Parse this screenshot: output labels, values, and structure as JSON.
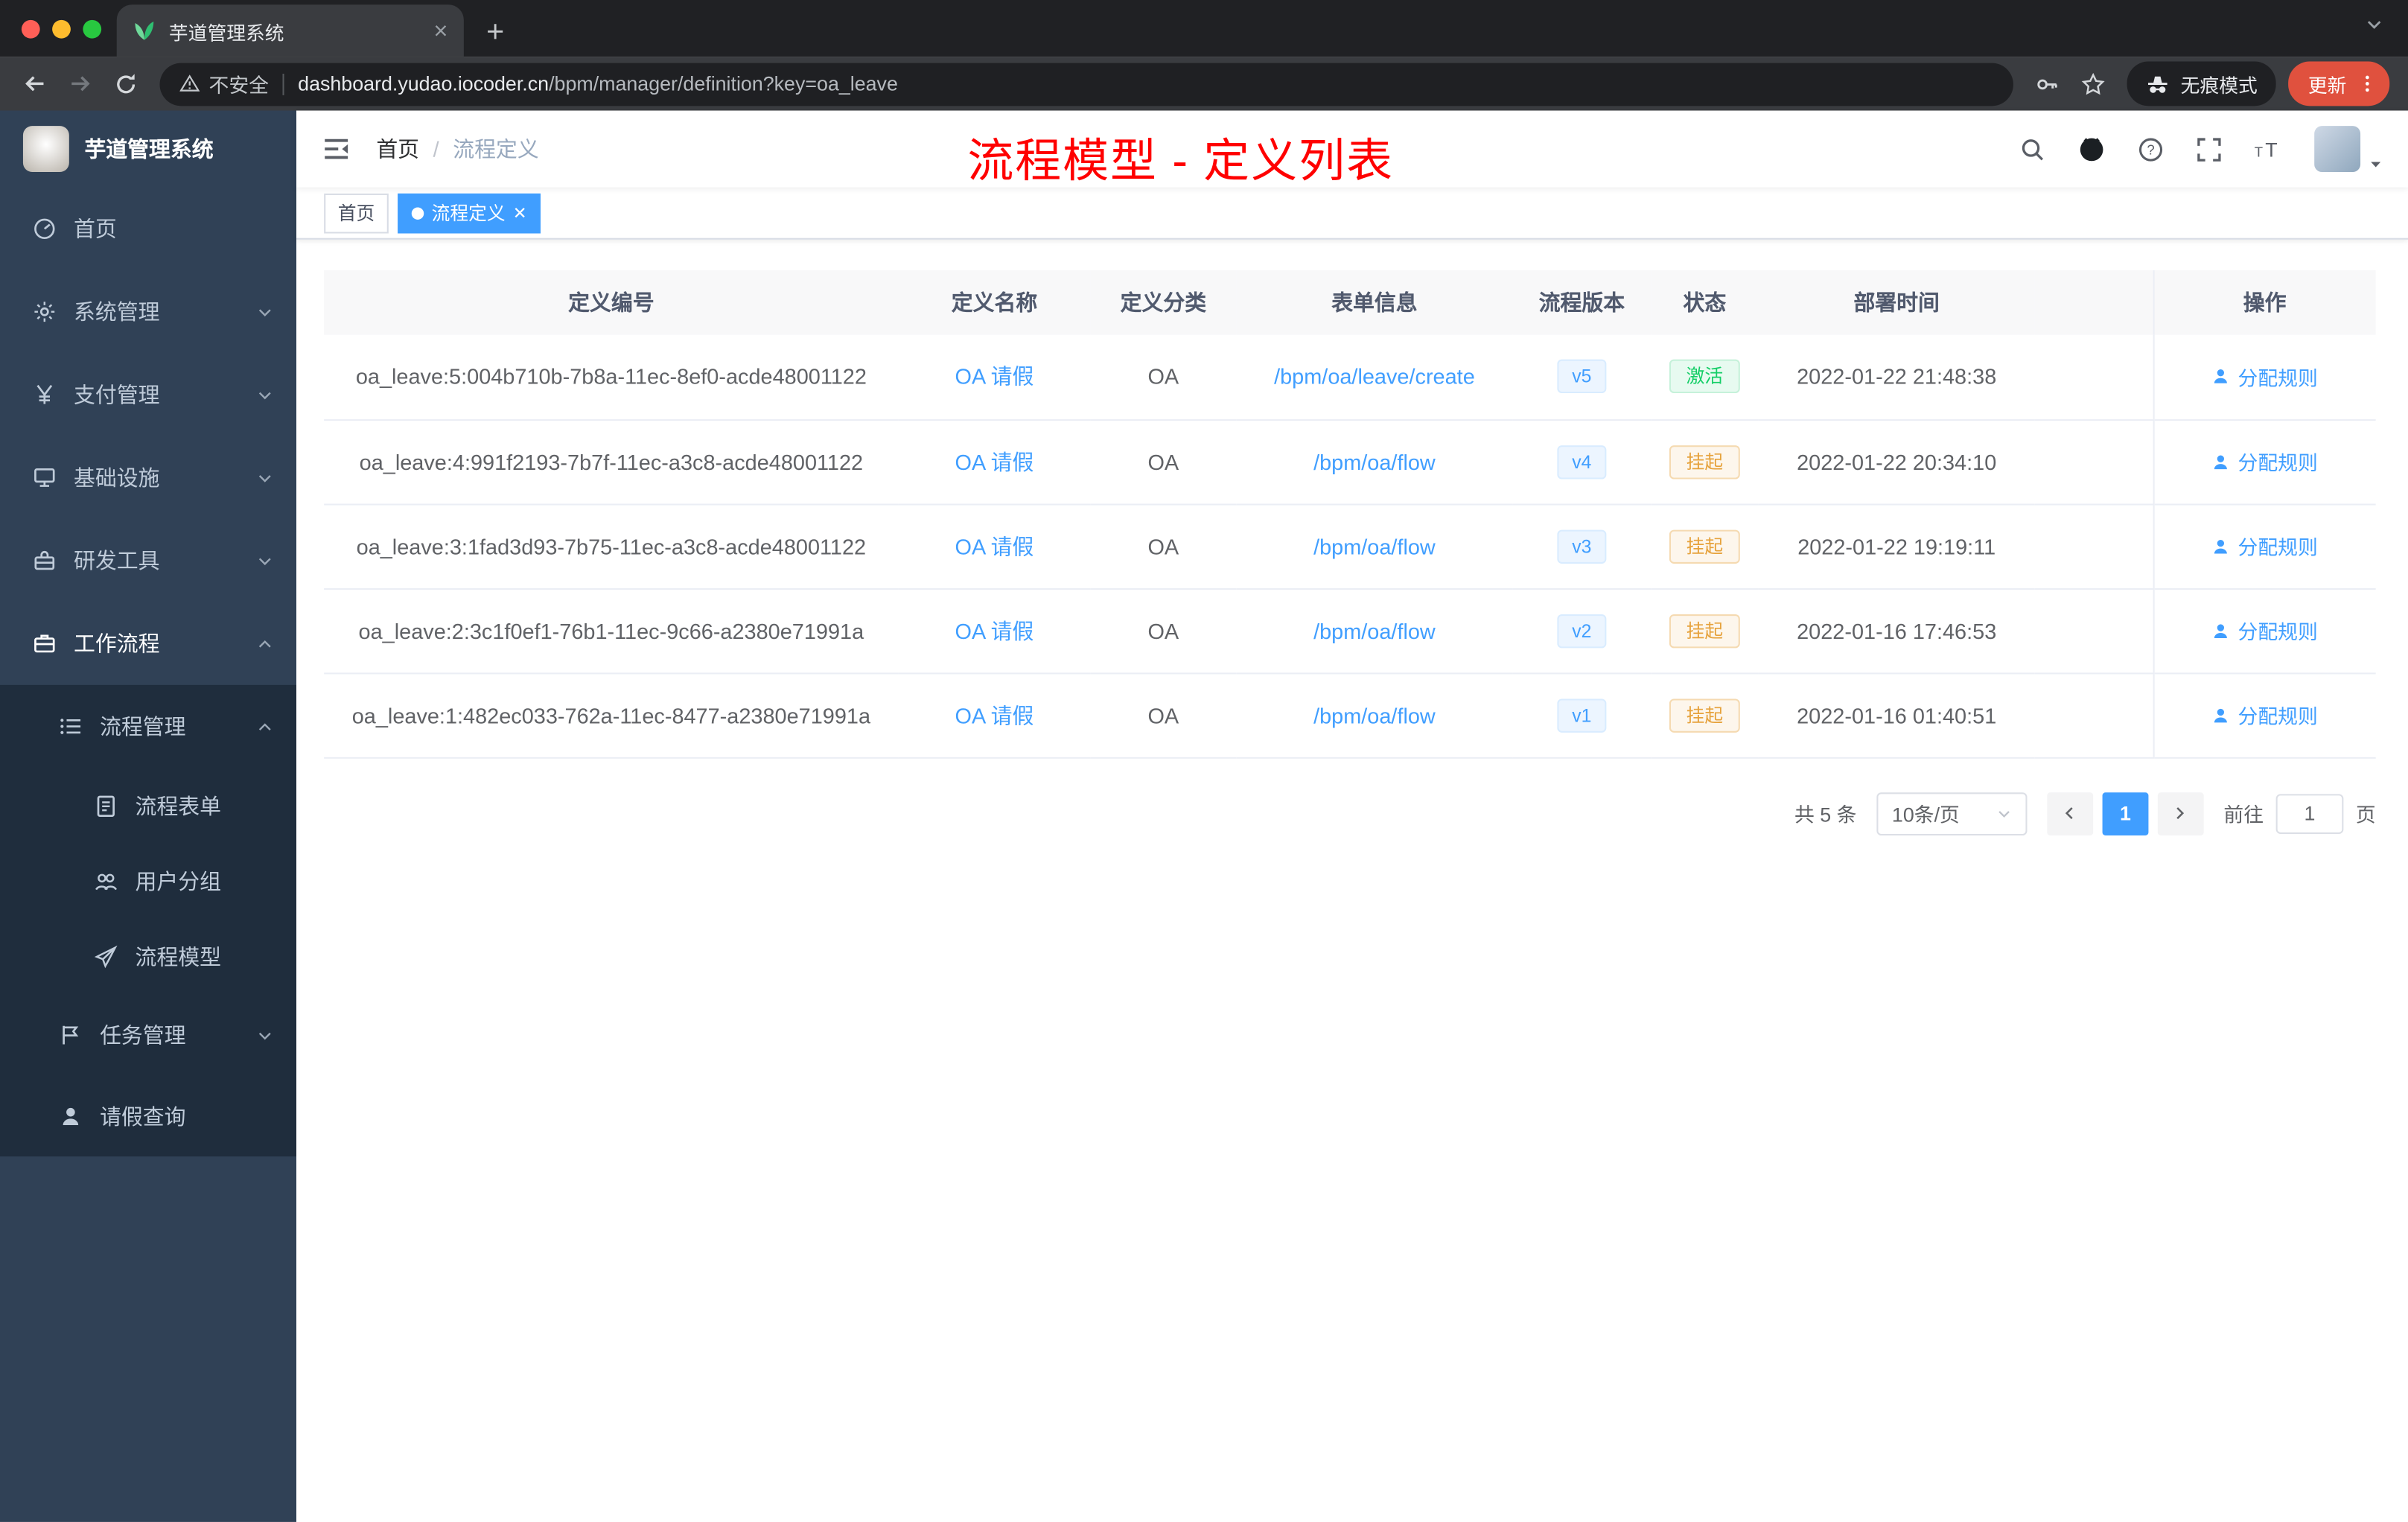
{
  "browser": {
    "tab_title": "芋道管理系统",
    "security_label": "不安全",
    "url_domain": "dashboard.yudao.iocoder.cn",
    "url_path": "/bpm/manager/definition?key=oa_leave",
    "incognito_label": "无痕模式",
    "update_label": "更新"
  },
  "sidebar": {
    "app_title": "芋道管理系统",
    "items": [
      {
        "label": "首页"
      },
      {
        "label": "系统管理"
      },
      {
        "label": "支付管理"
      },
      {
        "label": "基础设施"
      },
      {
        "label": "研发工具"
      },
      {
        "label": "工作流程"
      },
      {
        "label": "流程管理"
      },
      {
        "label": "流程表单"
      },
      {
        "label": "用户分组"
      },
      {
        "label": "流程模型"
      },
      {
        "label": "任务管理"
      },
      {
        "label": "请假查询"
      }
    ]
  },
  "navbar": {
    "breadcrumb_home": "首页",
    "breadcrumb_separator": "/",
    "breadcrumb_current": "流程定义"
  },
  "annotation": {
    "text": "流程模型 - 定义列表",
    "color": "#ff0000"
  },
  "tags": [
    {
      "label": "首页",
      "active": false
    },
    {
      "label": "流程定义",
      "active": true
    }
  ],
  "table": {
    "headers": [
      "定义编号",
      "定义名称",
      "定义分类",
      "表单信息",
      "流程版本",
      "状态",
      "部署时间",
      "操作"
    ],
    "rows": [
      {
        "id": "oa_leave:5:004b710b-7b8a-11ec-8ef0-acde48001122",
        "name": "OA 请假",
        "category": "OA",
        "form": "/bpm/oa/leave/create",
        "version": "v5",
        "status": "激活",
        "tone": "green",
        "time": "2022-01-22 21:48:38",
        "action": "分配规则"
      },
      {
        "id": "oa_leave:4:991f2193-7b7f-11ec-a3c8-acde48001122",
        "name": "OA 请假",
        "category": "OA",
        "form": "/bpm/oa/flow",
        "version": "v4",
        "status": "挂起",
        "tone": "orange",
        "time": "2022-01-22 20:34:10",
        "action": "分配规则"
      },
      {
        "id": "oa_leave:3:1fad3d93-7b75-11ec-a3c8-acde48001122",
        "name": "OA 请假",
        "category": "OA",
        "form": "/bpm/oa/flow",
        "version": "v3",
        "status": "挂起",
        "tone": "orange",
        "time": "2022-01-22 19:19:11",
        "action": "分配规则"
      },
      {
        "id": "oa_leave:2:3c1f0ef1-76b1-11ec-9c66-a2380e71991a",
        "name": "OA 请假",
        "category": "OA",
        "form": "/bpm/oa/flow",
        "version": "v2",
        "status": "挂起",
        "tone": "orange",
        "time": "2022-01-16 17:46:53",
        "action": "分配规则"
      },
      {
        "id": "oa_leave:1:482ec033-762a-11ec-8477-a2380e71991a",
        "name": "OA 请假",
        "category": "OA",
        "form": "/bpm/oa/flow",
        "version": "v1",
        "status": "挂起",
        "tone": "orange",
        "time": "2022-01-16 01:40:51",
        "action": "分配规则"
      }
    ]
  },
  "pagination": {
    "total_label": "共 5 条",
    "page_size_label": "10条/页",
    "current_page": "1",
    "goto_label": "前往",
    "goto_value": "1",
    "page_unit_label": "页"
  },
  "colors": {
    "accent": "#409eff",
    "annotation_red": "#ff0000",
    "status_active_green": "#13ce66",
    "status_suspended_orange": "#e6a23c",
    "sidebar_bg": "#304156",
    "submenu_bg": "#1f2d3d"
  }
}
